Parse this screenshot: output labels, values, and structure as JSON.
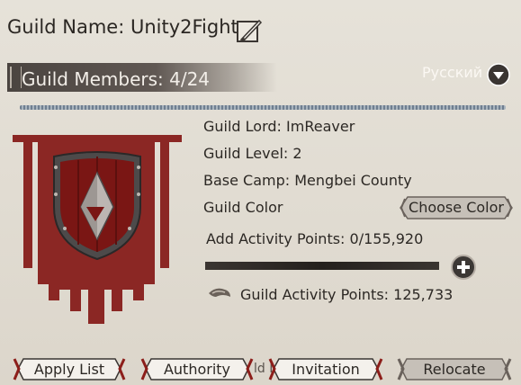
{
  "header": {
    "guild_name": "Guild Name: Unity2Fight",
    "edit_icon": "quill-edit-icon"
  },
  "members_bar": {
    "label": "Guild Members: 4/24"
  },
  "language": {
    "label": "Русский",
    "toggle_icon": "chevron-down-circle-icon"
  },
  "info": {
    "guild_lord": "Guild Lord: ImReaver",
    "guild_level": "Guild Level: 2",
    "base_camp": "Base Camp: Mengbei County",
    "guild_color": "Guild Color",
    "choose_color": "Choose Color",
    "add_activity": "Add Activity Points: 0/155,920",
    "add_activity_progress": 0,
    "guild_activity": "Guild Activity Points: 125,733"
  },
  "bottom": {
    "apply_list": "Apply List",
    "authority": "Authority",
    "hidden_text": "ld Lo",
    "invitation": "Invitation",
    "relocate": "Relocate"
  },
  "colors": {
    "banner": "#8b2724",
    "banner_dark": "#6a1a18",
    "shield_red": "#7a1614",
    "accent_red": "#8c1e1a"
  }
}
